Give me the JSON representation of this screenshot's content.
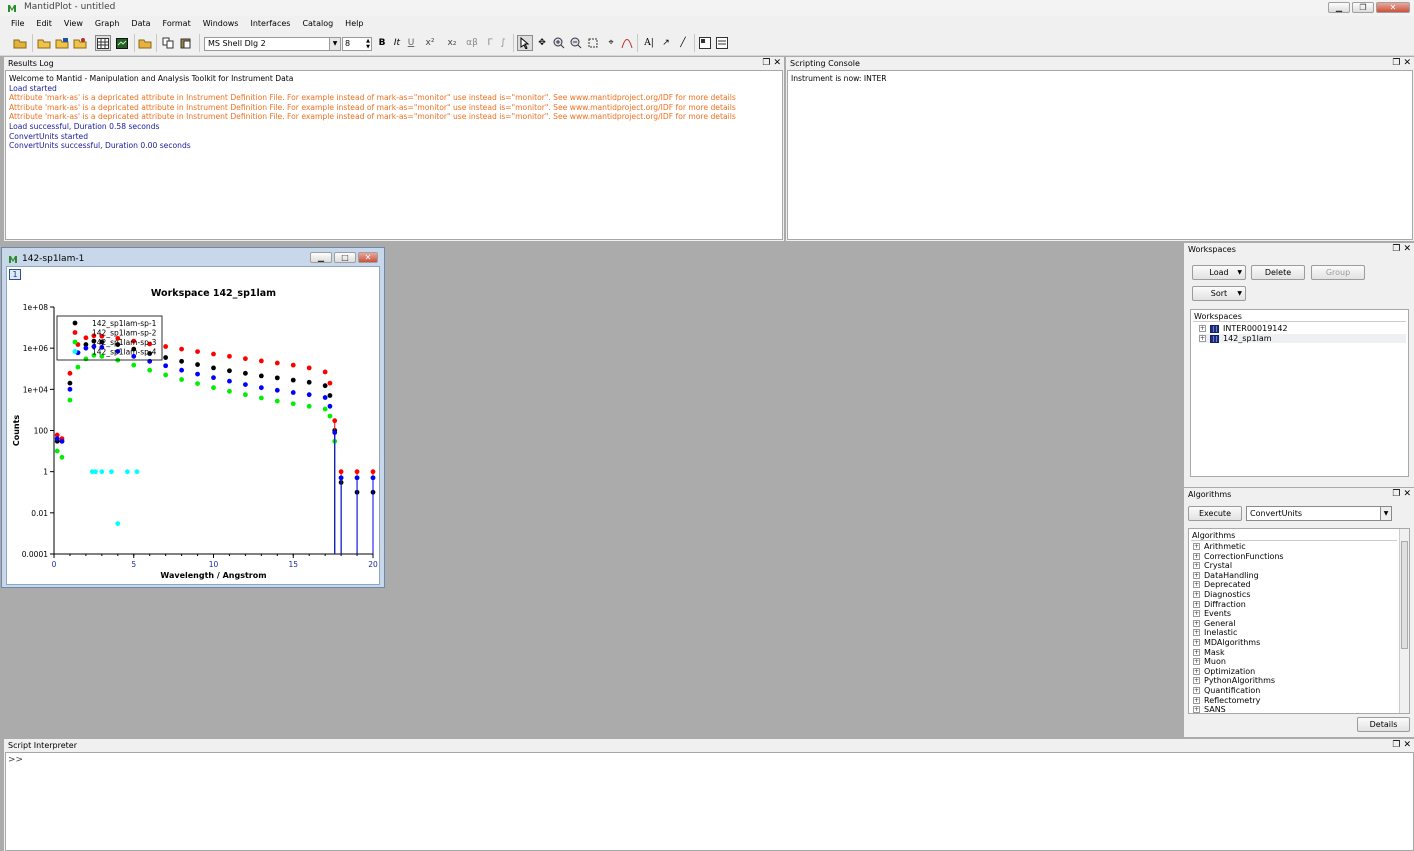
{
  "app": {
    "title": "MantidPlot - untitled"
  },
  "menu": [
    "File",
    "Edit",
    "View",
    "Graph",
    "Data",
    "Format",
    "Windows",
    "Interfaces",
    "Catalog",
    "Help"
  ],
  "toolbar": {
    "font_name": "MS Shell Dlg 2",
    "font_size": "8"
  },
  "results_log": {
    "title": "Results Log",
    "lines": [
      {
        "text": "Welcome to Mantid - Manipulation and Analysis Toolkit for Instrument Data",
        "color": "black"
      },
      {
        "text": "Load started",
        "color": "blue"
      },
      {
        "text": "Attribute 'mark-as' is a depricated attribute in Instrument Definition File. For example instead of mark-as=\"monitor\" use instead is=\"monitor\". See www.mantidproject.org/IDF for more details",
        "color": "orange"
      },
      {
        "text": "Attribute 'mark-as' is a depricated attribute in Instrument Definition File. For example instead of mark-as=\"monitor\" use instead is=\"monitor\". See www.mantidproject.org/IDF for more details",
        "color": "orange"
      },
      {
        "text": "Attribute 'mark-as' is a depricated attribute in Instrument Definition File. For example instead of mark-as=\"monitor\" use instead is=\"monitor\". See www.mantidproject.org/IDF for more details",
        "color": "orange"
      },
      {
        "text": "Load successful, Duration 0.58 seconds",
        "color": "blue"
      },
      {
        "text": "ConvertUnits started",
        "color": "blue"
      },
      {
        "text": "ConvertUnits successful, Duration 0.00 seconds",
        "color": "blue"
      }
    ]
  },
  "scripting_console": {
    "title": "Scripting Console",
    "text": "Instrument is now:  INTER"
  },
  "workspaces": {
    "title": "Workspaces",
    "load_label": "Load",
    "delete_label": "Delete",
    "group_label": "Group",
    "sort_label": "Sort",
    "tree_header": "Workspaces",
    "items": [
      "INTER00019142",
      "142_sp1lam"
    ]
  },
  "algorithms": {
    "title": "Algorithms",
    "execute_label": "Execute",
    "selected": "ConvertUnits",
    "tree_header": "Algorithms",
    "categories": [
      "Arithmetic",
      "CorrectionFunctions",
      "Crystal",
      "DataHandling",
      "Deprecated",
      "Diagnostics",
      "Diffraction",
      "Events",
      "General",
      "Inelastic",
      "MDAlgorithms",
      "Mask",
      "Muon",
      "Optimization",
      "PythonAlgorithms",
      "Quantification",
      "Reflectometry",
      "SANS"
    ],
    "details_label": "Details"
  },
  "script_interpreter": {
    "title": "Script Interpreter",
    "prompt": ">>"
  },
  "plot_window": {
    "title": "142-sp1lam-1",
    "layer_label": "1"
  },
  "chart_data": {
    "type": "scatter",
    "title": "Workspace 142_sp1lam",
    "xlabel": "Wavelength / Angstrom",
    "ylabel": "Counts",
    "xlim": [
      0,
      20
    ],
    "ylim": [
      0.0001,
      100000000
    ],
    "yscale": "log",
    "xticks": [
      "0",
      "5",
      "10",
      "15",
      "20"
    ],
    "yticks": [
      "1e+08",
      "1e+06",
      "1e+04",
      "100",
      "1",
      "0.01",
      "0.0001"
    ],
    "legend_position": "top-left",
    "series": [
      {
        "name": "142_sp1lam-sp-1",
        "color": "#000000",
        "x": [
          0.2,
          0.5,
          1,
          1.5,
          2,
          2.5,
          3,
          4,
          5,
          6,
          7,
          8,
          9,
          10,
          11,
          12,
          13,
          14,
          15,
          16,
          17,
          17.3,
          17.6,
          18,
          19,
          20
        ],
        "y": [
          30,
          30,
          20000,
          600000,
          1500000,
          2200000,
          2000000,
          1500000,
          900000,
          550000,
          350000,
          230000,
          160000,
          110000,
          80000,
          60000,
          45000,
          36000,
          28000,
          22000,
          15000,
          5000,
          100,
          0.3,
          0.1,
          0.1
        ]
      },
      {
        "name": "142_sp1lam-sp-2",
        "color": "#ff0000",
        "x": [
          0.2,
          0.5,
          1,
          1.5,
          2,
          2.5,
          3,
          4,
          5,
          6,
          7,
          8,
          9,
          10,
          11,
          12,
          13,
          14,
          15,
          16,
          17,
          17.3,
          17.6,
          18,
          19,
          20
        ],
        "y": [
          60,
          40,
          60000,
          1500000,
          3200000,
          4000000,
          3800000,
          3000000,
          2200000,
          1600000,
          1200000,
          900000,
          680000,
          520000,
          400000,
          310000,
          240000,
          190000,
          150000,
          110000,
          70000,
          20000,
          300,
          1,
          1,
          1
        ]
      },
      {
        "name": "142_sp1lam-sp-3",
        "color": "#00ee00",
        "x": [
          0.2,
          0.5,
          1,
          1.5,
          2,
          2.5,
          3,
          4,
          5,
          6,
          7,
          8,
          9,
          10,
          11,
          12,
          13,
          14,
          15,
          16,
          17,
          17.3,
          17.6,
          18,
          19,
          20
        ],
        "y": [
          10,
          5,
          3000,
          120000,
          300000,
          450000,
          400000,
          260000,
          150000,
          85000,
          50000,
          30000,
          19000,
          12000,
          8000,
          5500,
          3800,
          2700,
          2000,
          1500,
          1100,
          500,
          30,
          0.5,
          0.5,
          0.5
        ]
      },
      {
        "name": "142_sp1lam-sp-4",
        "color": "#00ffff",
        "x": [
          2.4,
          2.6,
          3,
          3.6,
          4,
          4.6,
          5.2
        ],
        "y": [
          1,
          1,
          1,
          1,
          0.003,
          1,
          1
        ]
      },
      {
        "name": "",
        "color": "#0000ff",
        "x": [
          0.2,
          0.5,
          1,
          1.5,
          2,
          2.5,
          3,
          4,
          5,
          6,
          7,
          8,
          9,
          10,
          11,
          12,
          13,
          14,
          15,
          16,
          17,
          17.3,
          17.6,
          18,
          19,
          20
        ],
        "y": [
          40,
          30,
          10000,
          600000,
          1000000,
          1200000,
          1100000,
          700000,
          400000,
          230000,
          140000,
          85000,
          55000,
          37000,
          25000,
          17000,
          12000,
          9000,
          7000,
          5500,
          4000,
          1500,
          80,
          0.5,
          0.5,
          0.5
        ]
      }
    ]
  }
}
